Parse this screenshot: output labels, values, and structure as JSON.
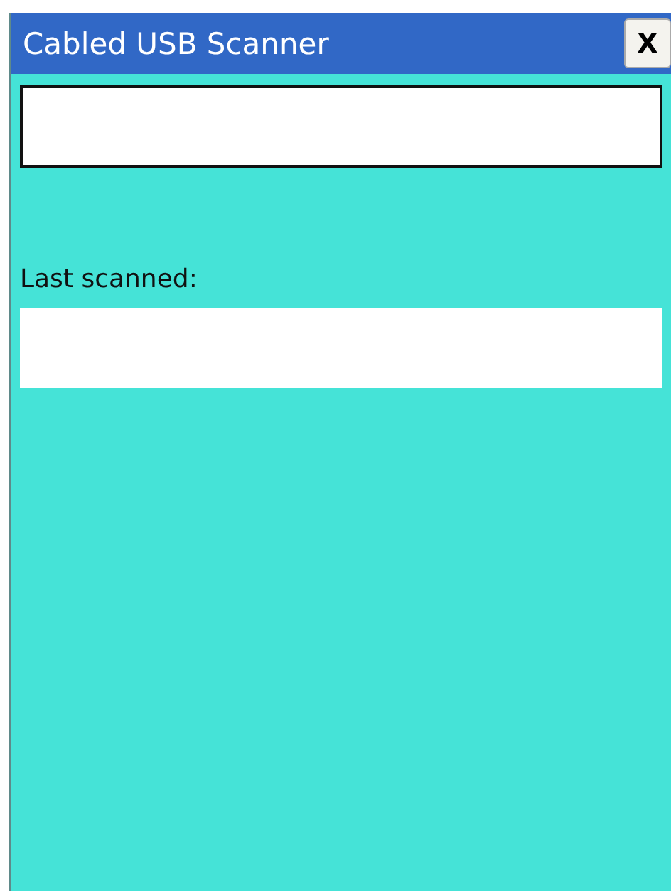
{
  "window": {
    "title": "Cabled USB Scanner",
    "close": "X"
  },
  "last_scanned": {
    "label": "Last scanned:"
  }
}
